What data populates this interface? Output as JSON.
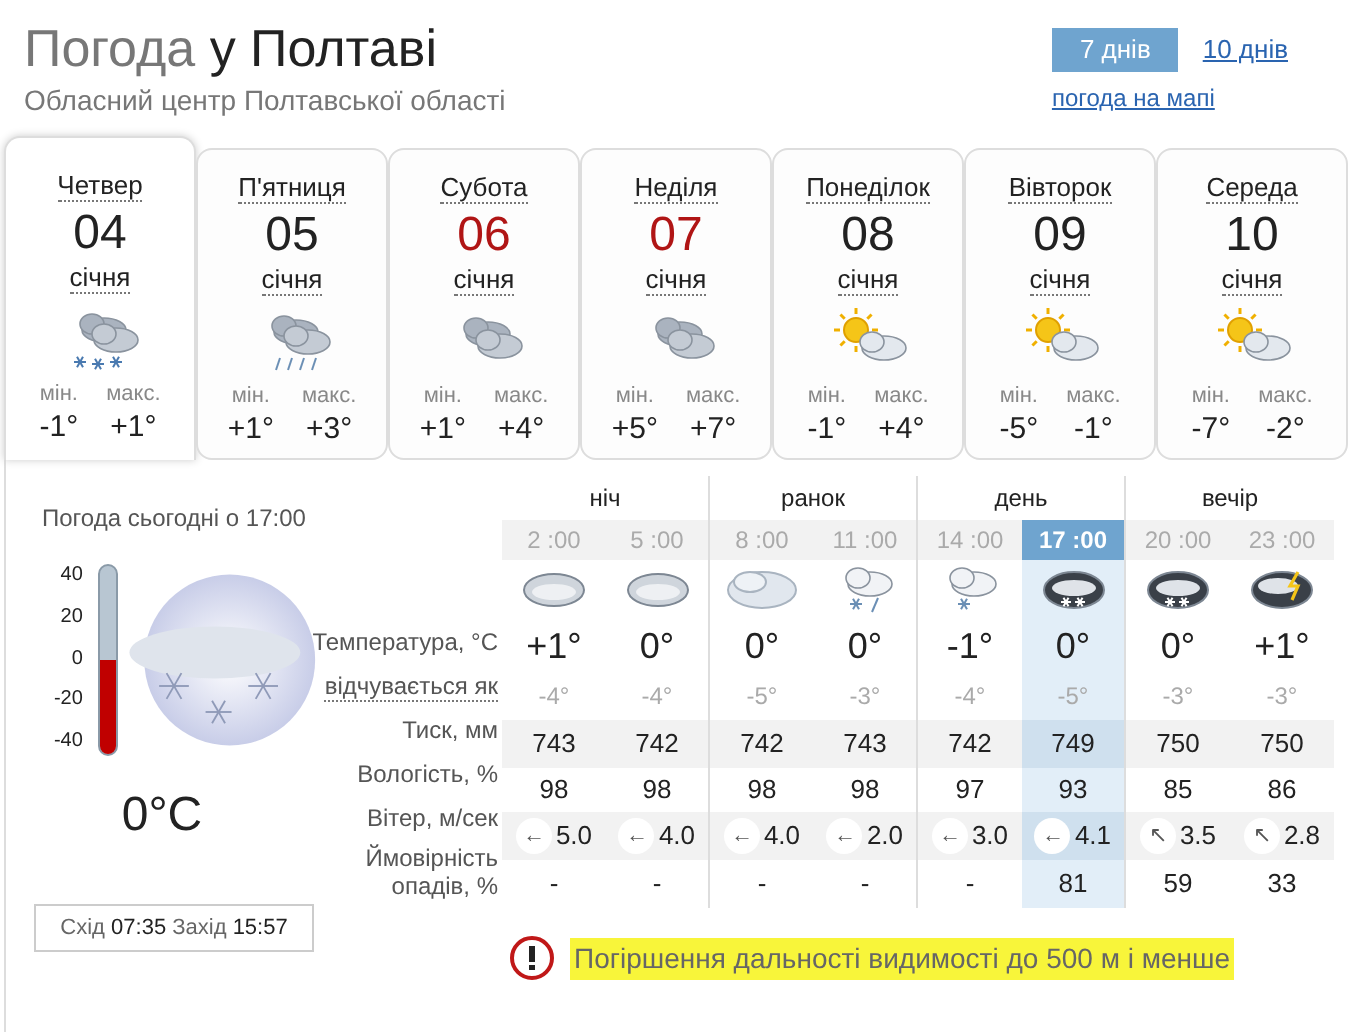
{
  "header": {
    "title_prefix": "Погода",
    "title_city": "у Полтаві",
    "subtitle": "Обласний центр Полтавської області"
  },
  "range_tabs": [
    {
      "label": "7 днів",
      "selected": true
    },
    {
      "label": "10 днів",
      "selected": false
    }
  ],
  "map_link": "погода на мапі",
  "days": [
    {
      "weekday": "Четвер",
      "date": "04",
      "month": "січня",
      "weekend": false,
      "selected": true,
      "kind": "snow",
      "min_label": "мін.",
      "min": "-1°",
      "max_label": "макс.",
      "max": "+1°"
    },
    {
      "weekday": "П'ятниця",
      "date": "05",
      "month": "січня",
      "weekend": false,
      "selected": false,
      "kind": "rain",
      "min_label": "мін.",
      "min": "+1°",
      "max_label": "макс.",
      "max": "+3°"
    },
    {
      "weekday": "Субота",
      "date": "06",
      "month": "січня",
      "weekend": true,
      "selected": false,
      "kind": "cloudy",
      "min_label": "мін.",
      "min": "+1°",
      "max_label": "макс.",
      "max": "+4°"
    },
    {
      "weekday": "Неділя",
      "date": "07",
      "month": "січня",
      "weekend": true,
      "selected": false,
      "kind": "cloudy",
      "min_label": "мін.",
      "min": "+5°",
      "max_label": "макс.",
      "max": "+7°"
    },
    {
      "weekday": "Понеділок",
      "date": "08",
      "month": "січня",
      "weekend": false,
      "selected": false,
      "kind": "partly",
      "min_label": "мін.",
      "min": "-1°",
      "max_label": "макс.",
      "max": "+4°"
    },
    {
      "weekday": "Вівторок",
      "date": "09",
      "month": "січня",
      "weekend": false,
      "selected": false,
      "kind": "partly",
      "min_label": "мін.",
      "min": "-5°",
      "max_label": "макс.",
      "max": "-1°"
    },
    {
      "weekday": "Середа",
      "date": "10",
      "month": "січня",
      "weekend": false,
      "selected": false,
      "kind": "partly",
      "min_label": "мін.",
      "min": "-7°",
      "max_label": "макс.",
      "max": "-2°"
    }
  ],
  "now": {
    "title": "Погода сьогодні о 17:00",
    "scale": [
      "40",
      "20",
      "0",
      "-20",
      "-40"
    ],
    "level": 0.5,
    "temperature": "0°C",
    "sunrise_label": "Схід",
    "sunrise": "07:35",
    "sunset_label": "Захід",
    "sunset": "15:57"
  },
  "row_labels": {
    "temperature": "Температура, °C",
    "feels": "відчувається як",
    "pressure": "Тиск, мм",
    "humidity": "Вологість, %",
    "wind": "Вітер, м/сек",
    "precip": "Ймовірність опадів, %"
  },
  "periods": [
    "ніч",
    "ранок",
    "день",
    "вечір"
  ],
  "hours": [
    {
      "time": "2 :00",
      "selected": false,
      "kind": "overcast",
      "temp": "+1°",
      "feels": "-4°",
      "pressure": "743",
      "humidity": "98",
      "wind_dir": "←",
      "wind": "5.0",
      "precip": "-"
    },
    {
      "time": "5 :00",
      "selected": false,
      "kind": "overcast",
      "temp": "0°",
      "feels": "-4°",
      "pressure": "742",
      "humidity": "98",
      "wind_dir": "←",
      "wind": "4.0",
      "precip": "-"
    },
    {
      "time": "8 :00",
      "selected": false,
      "kind": "light",
      "temp": "0°",
      "feels": "-5°",
      "pressure": "742",
      "humidity": "98",
      "wind_dir": "←",
      "wind": "4.0",
      "precip": "-"
    },
    {
      "time": "11 :00",
      "selected": false,
      "kind": "sleet",
      "temp": "0°",
      "feels": "-3°",
      "pressure": "743",
      "humidity": "98",
      "wind_dir": "←",
      "wind": "2.0",
      "precip": "-"
    },
    {
      "time": "14 :00",
      "selected": false,
      "kind": "lightsnow",
      "temp": "-1°",
      "feels": "-4°",
      "pressure": "742",
      "humidity": "97",
      "wind_dir": "←",
      "wind": "3.0",
      "precip": "-"
    },
    {
      "time": "17 :00",
      "selected": true,
      "kind": "nightsnow",
      "temp": "0°",
      "feels": "-5°",
      "pressure": "749",
      "humidity": "93",
      "wind_dir": "←",
      "wind": "4.1",
      "precip": "81"
    },
    {
      "time": "20 :00",
      "selected": false,
      "kind": "nightsnow",
      "temp": "0°",
      "feels": "-3°",
      "pressure": "750",
      "humidity": "85",
      "wind_dir": "↖",
      "wind": "3.5",
      "precip": "59"
    },
    {
      "time": "23 :00",
      "selected": false,
      "kind": "storm",
      "temp": "+1°",
      "feels": "-3°",
      "pressure": "750",
      "humidity": "86",
      "wind_dir": "↖",
      "wind": "2.8",
      "precip": "33"
    }
  ],
  "warning": {
    "text": "Погіршення дальності видимості до 500 м і менше",
    "highlighted": true
  }
}
